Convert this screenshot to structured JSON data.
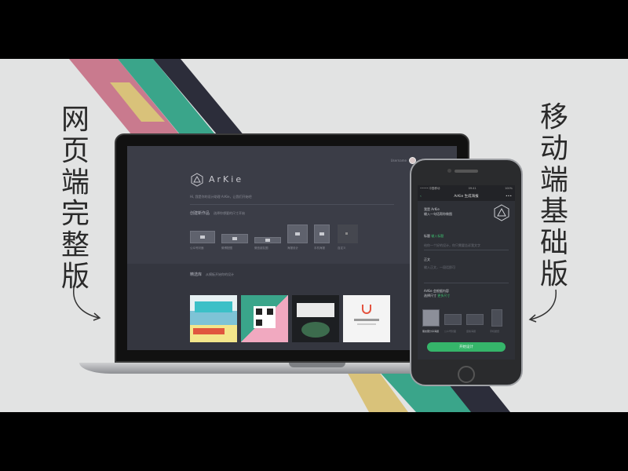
{
  "captions": {
    "left": [
      "网",
      "页",
      "端",
      "完",
      "整",
      "版"
    ],
    "right": [
      "移",
      "动",
      "端",
      "基",
      "础",
      "版"
    ]
  },
  "colors": {
    "background": "#e2e3e3",
    "stripe_teal": "#3aa58a",
    "stripe_dark": "#2c2d3a",
    "stripe_pink": "#c97a8e",
    "stripe_yellow": "#d9c27a",
    "accent_green": "#35b56a"
  },
  "laptop": {
    "brand": "ArKie",
    "user_name": "Username",
    "tagline": "Hi, 我是你的设计助理 ArKie，让我们开始吧",
    "create_title": "创建新作品",
    "create_hint": "选择你想要的尺寸开始",
    "tiles": [
      "公众号封面",
      "微博配图",
      "微信朋友圈",
      "海报设计",
      "手机海报",
      "自定义"
    ],
    "template_title": "精选库",
    "template_hint": "从模板开始你的设计",
    "thumbnails": [
      "travel-thumbnail",
      "qr-code-thumbnail",
      "photo-thumbnail",
      "logo-thumbnail"
    ]
  },
  "phone": {
    "status_left": "••••• 中国移动",
    "status_time": "09:41",
    "status_right": "100%",
    "nav_title": "ArKie 生成海报",
    "greeting_1": "我是 ArKie",
    "greeting_2": "输入一句话帮你做图",
    "field1_label": "标题",
    "field1_placeholder": "输入标题",
    "field2_placeholder": "给你一个好的设计，你只需要告诉我文字",
    "field3_label": "正文",
    "field3_placeholder": "输入正文，一段话即可",
    "option_label": "ArKie 会根据内容",
    "option_value": "选择尺寸",
    "option_link": "更多尺寸",
    "tiles": [
      "朋友圈分享海报",
      "公众号封面",
      "竖版海报",
      "手机壁纸"
    ],
    "cta": "开始设计"
  }
}
